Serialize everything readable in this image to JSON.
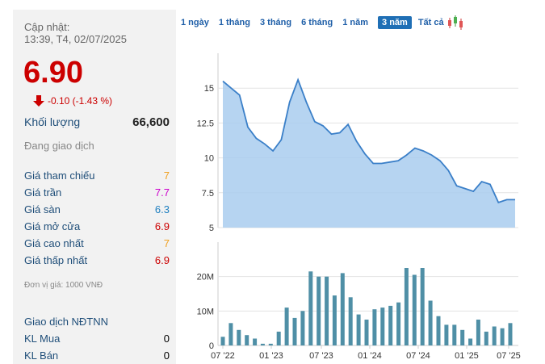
{
  "quote": {
    "updated_label": "Cập nhật:",
    "updated_time": "13:39, T4, 02/07/2025",
    "price": "6.90",
    "change": "-0.10 (-1.43 %)",
    "volume_label": "Khối lượng",
    "volume_value": "66,600",
    "status": "Đang giao dịch"
  },
  "price_rows": [
    {
      "label": "Giá tham chiếu",
      "value": "7",
      "color": "#f0a020"
    },
    {
      "label": "Giá trần",
      "value": "7.7",
      "color": "#cc00cc"
    },
    {
      "label": "Giá sàn",
      "value": "6.3",
      "color": "#2080c0"
    },
    {
      "label": "Giá mở cửa",
      "value": "6.9",
      "color": "#cc0000"
    },
    {
      "label": "Giá cao nhất",
      "value": "7",
      "color": "#f0a020"
    },
    {
      "label": "Giá thấp nhất",
      "value": "6.9",
      "color": "#cc0000"
    }
  ],
  "unit_note": "Đơn vị giá: 1000 VNĐ",
  "foreign": {
    "title": "Giao dịch NĐTNN",
    "rows": [
      {
        "label": "KL Mua",
        "value": "0"
      },
      {
        "label": "KL Bán",
        "value": "0"
      }
    ]
  },
  "tabs": [
    {
      "label": "1 ngày",
      "active": false
    },
    {
      "label": "1 tháng",
      "active": false
    },
    {
      "label": "3 tháng",
      "active": false
    },
    {
      "label": "6 tháng",
      "active": false
    },
    {
      "label": "1 năm",
      "active": false
    },
    {
      "label": "3 năm",
      "active": true
    },
    {
      "label": "Tất cả",
      "active": false
    }
  ],
  "colors": {
    "down": "#cc0000",
    "price_line": "#3a7fc8",
    "price_fill": "#a9cdee",
    "volume_bar": "#4f8fa6"
  },
  "chart_data": [
    {
      "type": "area",
      "x": [
        0,
        1,
        2,
        3,
        4,
        5,
        6,
        7,
        8,
        9,
        10,
        11,
        12,
        13,
        14,
        15,
        16,
        17,
        18,
        19,
        20,
        21,
        22,
        23,
        24,
        25,
        26,
        27,
        28,
        29,
        30,
        31,
        32,
        33,
        34,
        35
      ],
      "values": [
        15.5,
        15.0,
        14.5,
        12.2,
        11.4,
        11.0,
        10.5,
        11.3,
        14.0,
        15.6,
        14.0,
        12.6,
        12.3,
        11.7,
        11.8,
        12.4,
        11.2,
        10.3,
        9.6,
        9.6,
        9.7,
        9.8,
        10.2,
        10.7,
        10.5,
        10.2,
        9.8,
        9.1,
        8.0,
        7.8,
        7.6,
        8.3,
        8.1,
        6.8,
        7.0,
        7.0
      ],
      "y_ticks": [
        "15",
        "12.5",
        "10",
        "7.5",
        "5"
      ],
      "y_tick_values": [
        15,
        12.5,
        10,
        7.5,
        5
      ],
      "ylim": [
        5,
        17.5
      ],
      "grid": true
    },
    {
      "type": "bar",
      "values": [
        2.5,
        6.5,
        4.5,
        3.0,
        2.0,
        0.5,
        0.5,
        4.0,
        11.0,
        8.0,
        10.0,
        21.5,
        20.0,
        20.0,
        14.5,
        21.0,
        14.0,
        9.0,
        7.5,
        10.5,
        11.0,
        11.5,
        12.5,
        22.5,
        20.5,
        22.5,
        13.0,
        8.5,
        6.0,
        6.0,
        4.5,
        2.0,
        7.5,
        4.0,
        5.5,
        5.0,
        6.5
      ],
      "y_ticks": [
        "20M",
        "10M",
        "0"
      ],
      "y_tick_values": [
        20,
        10,
        0
      ],
      "ylim": [
        0,
        30
      ],
      "x_ticks": [
        "07 '22",
        "01 '23",
        "07 '23",
        "01 '24",
        "07 '24",
        "01 '25",
        "07 '25"
      ],
      "grid": true
    }
  ]
}
